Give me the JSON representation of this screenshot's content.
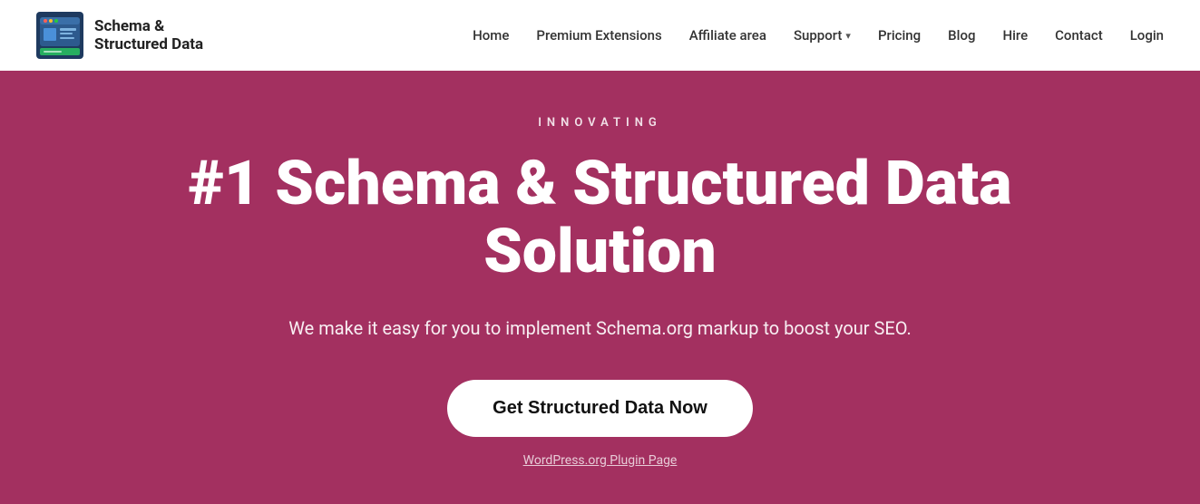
{
  "header": {
    "logo": {
      "text_line1": "Schema &",
      "text_line2": "Structured Data"
    },
    "nav": {
      "items": [
        {
          "label": "Home",
          "id": "home",
          "has_dropdown": false
        },
        {
          "label": "Premium Extensions",
          "id": "premium-extensions",
          "has_dropdown": false
        },
        {
          "label": "Affiliate area",
          "id": "affiliate-area",
          "has_dropdown": false
        },
        {
          "label": "Support",
          "id": "support",
          "has_dropdown": true
        },
        {
          "label": "Pricing",
          "id": "pricing",
          "has_dropdown": false
        },
        {
          "label": "Blog",
          "id": "blog",
          "has_dropdown": false
        },
        {
          "label": "Hire",
          "id": "hire",
          "has_dropdown": false
        },
        {
          "label": "Contact",
          "id": "contact",
          "has_dropdown": false
        },
        {
          "label": "Login",
          "id": "login",
          "has_dropdown": false
        }
      ]
    }
  },
  "hero": {
    "tagline": "INNOVATING",
    "title": "#1 Schema & Structured Data Solution",
    "subtitle": "We make it easy for you to implement Schema.org markup to boost your SEO.",
    "cta_label": "Get Structured Data Now",
    "link_label": "WordPress.org Plugin Page"
  },
  "colors": {
    "hero_bg": "#a33060",
    "header_bg": "#ffffff",
    "cta_bg": "#ffffff",
    "cta_text": "#111111"
  }
}
